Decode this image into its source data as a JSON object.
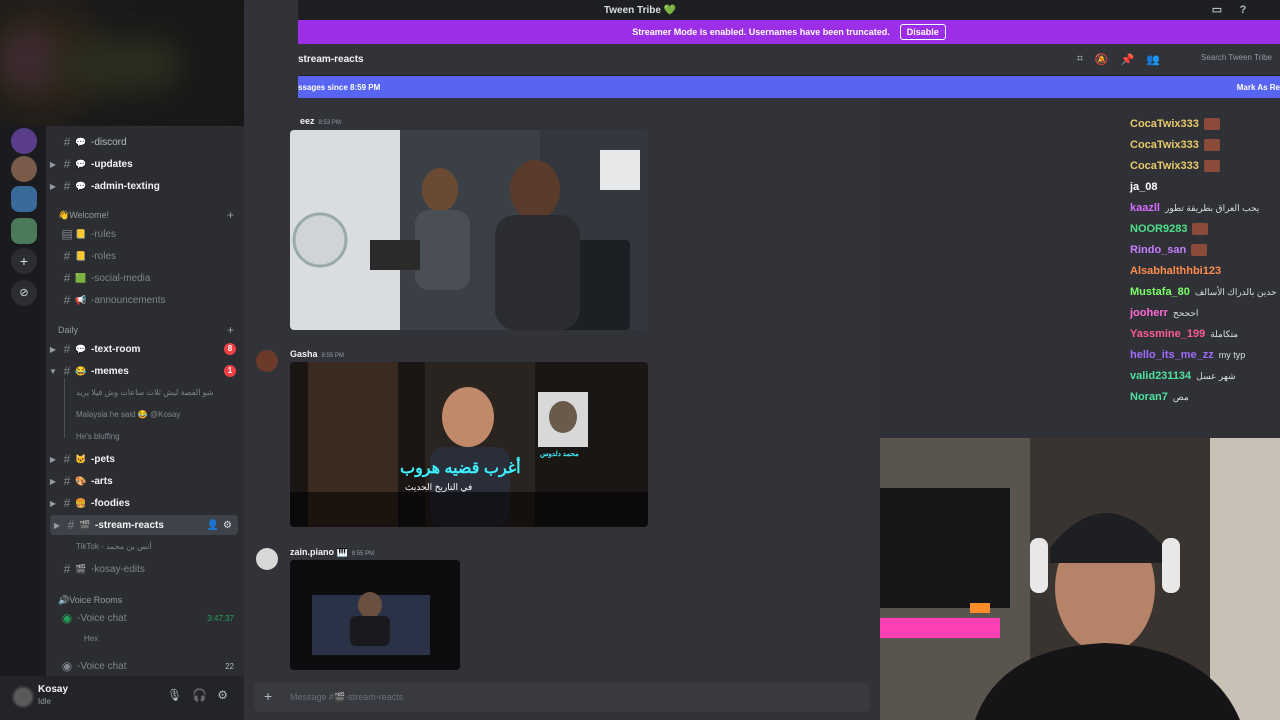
{
  "titlebar": {
    "server_title": "Tween Tribe 💚"
  },
  "banner": {
    "text": "Streamer Mode is enabled. Usernames have been truncated.",
    "button": "Disable"
  },
  "header": {
    "channel": "stream-reacts",
    "search_placeholder": "Search Tween Tribe"
  },
  "new_bar": {
    "left": "ssages since 8:59 PM",
    "right": "Mark As Re"
  },
  "channels": {
    "top": [
      {
        "name": "-discord",
        "emoji": "💬"
      },
      {
        "name": "-updates",
        "emoji": "💬"
      },
      {
        "name": "-admin-texting",
        "emoji": "💬"
      }
    ],
    "cat_welcome": "👋Welcome!",
    "welcome": [
      {
        "name": "-rules",
        "emoji": "📒"
      },
      {
        "name": "-roles",
        "emoji": "📒"
      },
      {
        "name": "-social-media",
        "emoji": "🟩"
      },
      {
        "name": "-announcements",
        "emoji": "📢"
      }
    ],
    "cat_daily": "Daily",
    "daily": [
      {
        "name": "-text-room",
        "emoji": "💬",
        "badge": "8"
      },
      {
        "name": "-memes",
        "emoji": "😂",
        "badge": "1"
      }
    ],
    "threads": [
      "شو الفصة ليش ثلاث ساعات وش فيلا يريد",
      "Malaysia he said 😂 @Kosay",
      "He's bluffing"
    ],
    "daily2": [
      {
        "name": "-pets",
        "emoji": "🐱"
      },
      {
        "name": "-arts",
        "emoji": "🎨"
      },
      {
        "name": "-foodies",
        "emoji": "🍔"
      },
      {
        "name": "-stream-reacts",
        "emoji": "🎬"
      }
    ],
    "thread_tiktok": "TikTok - أنس بن محمد",
    "kosay_edits": {
      "name": "-kosay-edits",
      "emoji": "🎬"
    },
    "cat_voice": "🔊Voice Rooms",
    "voice1": {
      "name": "-Voice chat",
      "time": "3:47:37"
    },
    "voice_user": "Hex",
    "voice2": {
      "name": "-Voice chat",
      "count": "22"
    }
  },
  "user": {
    "name": "Kosay",
    "status": "Idle"
  },
  "messages": [
    {
      "author": "eez",
      "time": "8:53 PM"
    },
    {
      "author": "Gasha",
      "time": "8:55 PM"
    },
    {
      "author": "zain.piano 🎹",
      "time": "8:55 PM"
    }
  ],
  "thumb2": {
    "headline": "أغرب قضيه هروب",
    "sub": "في التاريخ الحديث",
    "tag": "محمد دلدوس"
  },
  "composer": {
    "placeholder": "Message #🎬-stream-reacts"
  },
  "twitch_chat": [
    {
      "user": "CocaTwix333",
      "color": "#e8c96a",
      "msg": ""
    },
    {
      "user": "CocaTwix333",
      "color": "#e8c96a",
      "msg": ""
    },
    {
      "user": "CocaTwix333",
      "color": "#e8c96a",
      "msg": ""
    },
    {
      "user": "ja_08",
      "color": "#ffffff",
      "msg": ""
    },
    {
      "user": "kaazll",
      "color": "#d36cff",
      "msg": "يحب العراق بطريقة تطور"
    },
    {
      "user": "NOOR9283",
      "color": "#4ee08a",
      "msg": ""
    },
    {
      "user": "Rindo_san",
      "color": "#c77dff",
      "msg": ""
    },
    {
      "user": "Alsabhalthhbi123",
      "color": "#ff8c4d",
      "msg": ""
    },
    {
      "user": "Mustafa_80",
      "color": "#7fff6b",
      "msg": "حدين بالدراك الأسالف"
    },
    {
      "user": "jooherr",
      "color": "#ff6bd6",
      "msg": "احححح"
    },
    {
      "user": "Yassmine_199",
      "color": "#ff5d8f",
      "msg": "متكاملة"
    },
    {
      "user": "hello_its_me_zz",
      "color": "#a06bff",
      "msg": "my typ"
    },
    {
      "user": "valid231134",
      "color": "#4ee0a0",
      "msg": "شهر عسل"
    },
    {
      "user": "Noran7",
      "color": "#4ee0a0",
      "msg": "مص"
    }
  ]
}
